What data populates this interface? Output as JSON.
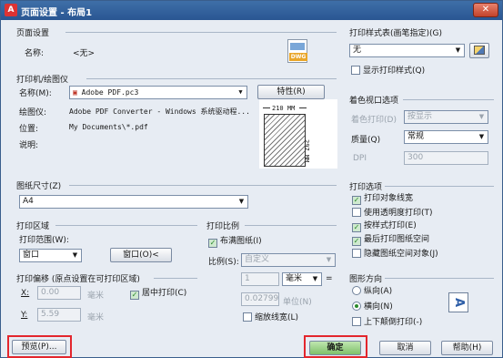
{
  "window": {
    "title": "页面设置 - 布局1",
    "close_glyph": "✕",
    "app_icon": "autocad-icon"
  },
  "page_setup": {
    "group": "页面设置",
    "name_label": "名称:",
    "name_value": "<无>",
    "file_icon_text": "DWG"
  },
  "printer": {
    "group": "打印机/绘图仪",
    "name_label": "名称(M):",
    "name_value": "Adobe PDF.pc3",
    "properties_button": "特性(R)",
    "plotter_label": "绘图仪:",
    "plotter_value": "Adobe PDF Converter - Windows 系统驱动程...",
    "location_label": "位置:",
    "location_value": "My Documents\\*.pdf",
    "desc_label": "说明:",
    "preview_width": "210 MM",
    "preview_height": "297 MM"
  },
  "paper": {
    "group": "图纸尺寸(Z)",
    "value": "A4"
  },
  "plot_area": {
    "group": "打印区域",
    "range_label": "打印范围(W):",
    "range_value": "窗口",
    "window_button": "窗口(O)<"
  },
  "plot_offset": {
    "group": "打印偏移 (原点设置在可打印区域)",
    "x_label": "X:",
    "x_value": "0.00",
    "x_unit": "毫米",
    "center_label": "居中打印(C)",
    "y_label": "Y:",
    "y_value": "5.59",
    "y_unit": "毫米"
  },
  "plot_scale": {
    "group": "打印比例",
    "fit_label": "布满图纸(I)",
    "scale_label": "比例(S):",
    "scale_value": "自定义",
    "value1": "1",
    "unit": "毫米",
    "equals": "=",
    "value2": "0.02799",
    "unit2": "单位(N)",
    "lineweight_label": "缩放线宽(L)"
  },
  "style_table": {
    "group": "打印样式表(画笔指定)(G)",
    "value": "无",
    "edit_icon": "edit-icon",
    "show_label": "显示打印样式(Q)"
  },
  "shaded": {
    "group": "着色视口选项",
    "shade_label": "着色打印(D)",
    "shade_value": "按显示",
    "quality_label": "质量(Q)",
    "quality_value": "常规",
    "dpi_label": "DPI",
    "dpi_value": "300"
  },
  "plot_options": {
    "group": "打印选项",
    "items": [
      {
        "label": "打印对象线宽",
        "checked": true
      },
      {
        "label": "使用透明度打印(T)",
        "checked": false
      },
      {
        "label": "按样式打印(E)",
        "checked": true
      },
      {
        "label": "最后打印图纸空间",
        "checked": true
      },
      {
        "label": "隐藏图纸空间对象(J)",
        "checked": false
      }
    ]
  },
  "orientation": {
    "group": "图形方向",
    "portrait": "纵向(A)",
    "landscape": "横向(N)",
    "upside": "上下颠倒打印(-)",
    "icon_glyph": "A"
  },
  "footer": {
    "preview": "预览(P)...",
    "ok": "确定",
    "cancel": "取消",
    "help": "帮助(H)"
  },
  "accent": {
    "check_green": "#2a8a2a",
    "highlight_red": "#e3262d"
  }
}
